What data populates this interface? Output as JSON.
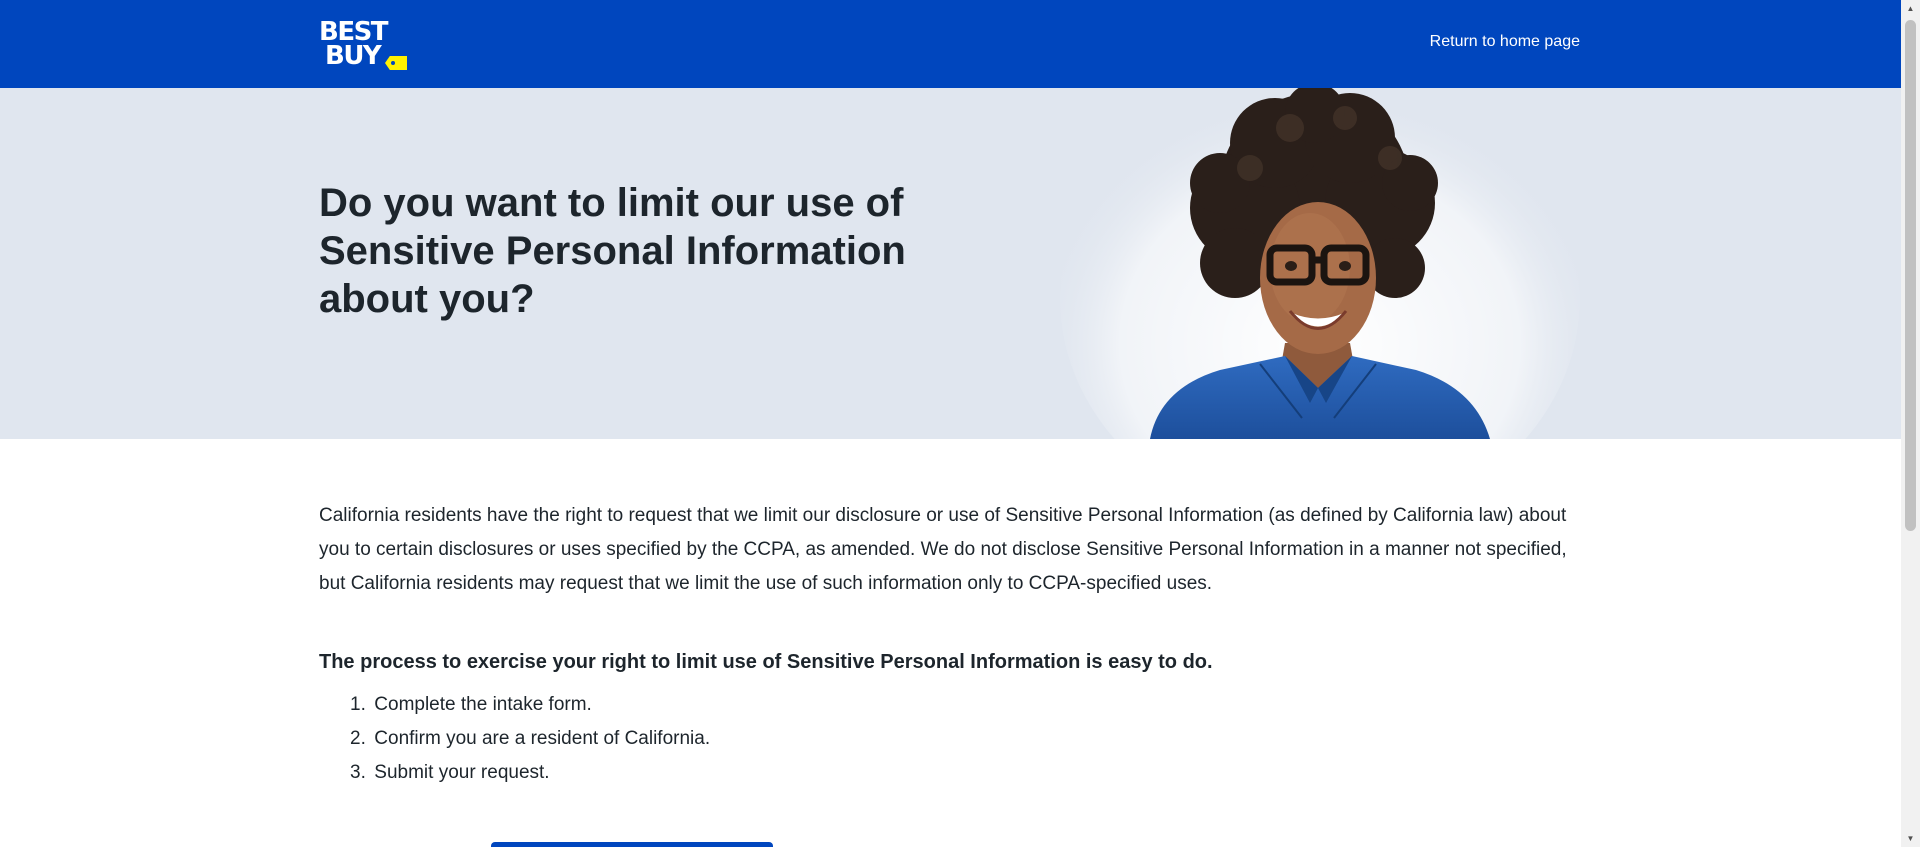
{
  "header": {
    "logo_line1": "BEST",
    "logo_line2": "BUY",
    "return_link": "Return to home page",
    "background_color": "#0046be",
    "tag_color": "#fff200"
  },
  "hero": {
    "title": "Do you want to limit our use of Sensitive Personal Information about you?",
    "background_color": "#e0e6ef",
    "image": "smiling-employee-portrait"
  },
  "main": {
    "intro": "California residents have the right to request that we limit our disclosure or use of Sensitive Personal Information (as defined by California law) about you to certain disclosures or uses specified by the CCPA, as amended. We do not disclose Sensitive Personal Information in a manner not specified, but California residents may request that we limit the use of such information only to CCPA-specified uses.",
    "process_heading": "The process to exercise your right to limit use of Sensitive Personal Information is easy to do.",
    "steps": [
      {
        "number": "1.",
        "text": "Complete the intake form."
      },
      {
        "number": "2.",
        "text": "Confirm you are a resident of California."
      },
      {
        "number": "3.",
        "text": "Submit your request."
      }
    ]
  },
  "scrollbar": {
    "up_icon": "triangle-up",
    "down_icon": "triangle-down"
  }
}
